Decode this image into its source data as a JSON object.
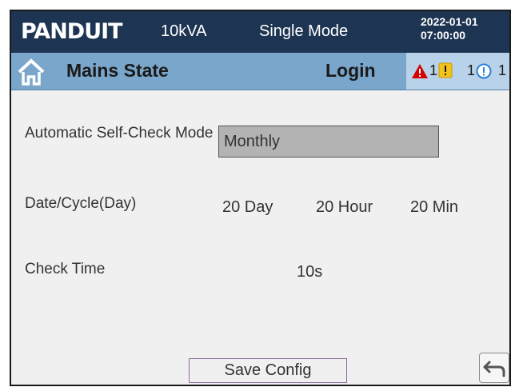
{
  "header": {
    "logo_text": "PANDUIT",
    "rating": "10kVA",
    "mode": "Single Mode",
    "date": "2022-01-01",
    "time": "07:00:00"
  },
  "subheader": {
    "home_icon": "home-icon",
    "title": "Mains State",
    "login_label": "Login",
    "alarms": [
      {
        "icon": "warning-triangle-icon",
        "count": "1",
        "color": "#d40000"
      },
      {
        "icon": "exclamation-square-icon",
        "count": "",
        "color": "#f2c21a"
      },
      {
        "icon": "info-circle-icon",
        "count": "1",
        "color": "#2b7fd6"
      },
      {
        "icon": "",
        "count": "1",
        "color": ""
      }
    ]
  },
  "settings": {
    "self_check_label": "Automatic Self-Check Mode",
    "self_check_value": "Monthly",
    "date_cycle_label": "Date/Cycle(Day)",
    "date_cycle_day": "20 Day",
    "date_cycle_hour": "20 Hour",
    "date_cycle_min": "20 Min",
    "check_time_label": "Check Time",
    "check_time_value": "10s"
  },
  "footer": {
    "save_label": "Save Config",
    "back_icon": "back-arrow-icon"
  },
  "colors": {
    "header_bg": "#1d3452",
    "subheader_bg": "#7aa6cc",
    "alarm_panel_bg": "#b8d2ea",
    "body_bg": "#f0f0f0",
    "field_bg": "#b3b3b3"
  }
}
